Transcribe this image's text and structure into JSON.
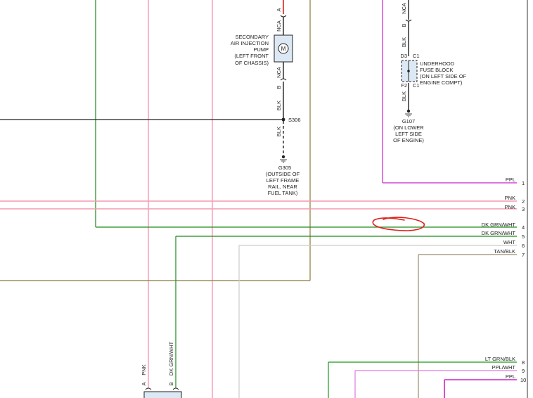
{
  "colors": {
    "green": "#1a8a1a",
    "pink": "#f06a8a",
    "olive": "#8a7a3a",
    "magenta": "#cc22cc",
    "lightgray": "#c8c8c8",
    "black": "#222222",
    "red": "#e0201a",
    "tan": "#9a8a6a"
  },
  "air_pump": {
    "label": [
      "SECONDARY",
      "AIR INJECTION",
      "PUMP",
      "(LEFT FRONT",
      "OF CHASSIS)"
    ],
    "pin_a": "A",
    "pin_b": "B",
    "nca_top": "NCA",
    "nca_bottom": "NCA",
    "motor_symbol": "M",
    "wire_color": "BLK"
  },
  "splice": {
    "id": "S306",
    "wire_color": "BLK"
  },
  "ground_g305": {
    "id": "G305",
    "label": [
      "(OUTSIDE OF",
      "LEFT FRAME",
      "RAIL, NEAR",
      "FUEL TANK)"
    ]
  },
  "fuse_block": {
    "label": [
      "UNDERHOOD",
      "FUSE BLOCK",
      "(ON LEFT SIDE OF",
      "ENGINE COMPT)"
    ],
    "pin_top_left": "D3",
    "pin_top_right": "C1",
    "pin_bottom_left": "F2",
    "pin_bottom_right": "C1",
    "nca": "NCA",
    "pin_b": "B",
    "wire_top": "BLK",
    "wire_bottom": "BLK"
  },
  "ground_g107": {
    "id": "G107",
    "label": [
      "(ON LOWER",
      "LEFT SIDE",
      "OF ENGINE)"
    ]
  },
  "connector_rows": [
    {
      "label": "PPL",
      "pin": "1"
    },
    {
      "label": "PNK",
      "pin": "2"
    },
    {
      "label": "PNK",
      "pin": "3"
    },
    {
      "label": "DK GRN/WHT",
      "pin": "4"
    },
    {
      "label": "DK GRN/WHT",
      "pin": "5"
    },
    {
      "label": "WHT",
      "pin": "6"
    },
    {
      "label": "TAN/BLK",
      "pin": "7"
    },
    {
      "label": "LT GRN/BLK",
      "pin": "8"
    },
    {
      "label": "PPL/WHT",
      "pin": "9"
    },
    {
      "label": "PPL",
      "pin": "10"
    }
  ],
  "bottom_connector": {
    "pin_a": "A",
    "pin_b": "B",
    "wire_a": "PNK",
    "wire_b": "DK GRN/WHT"
  }
}
